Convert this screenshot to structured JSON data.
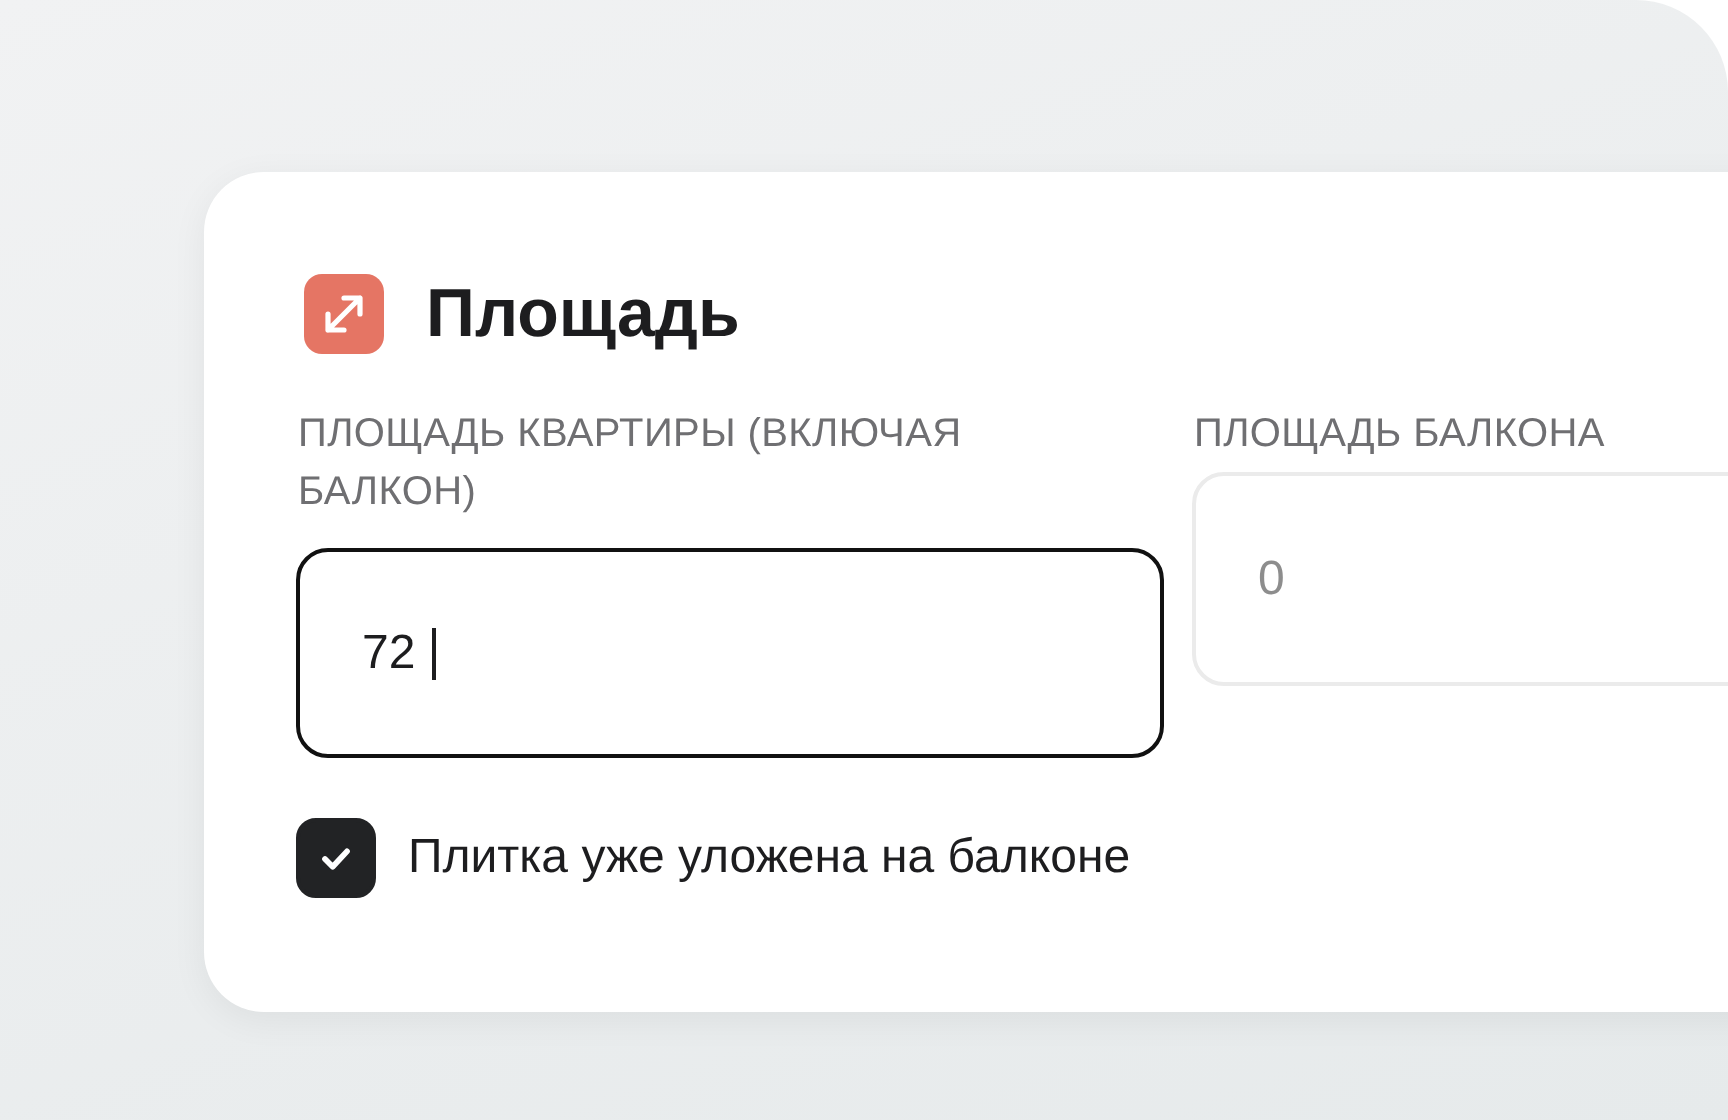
{
  "card": {
    "title": "Площадь",
    "fields": [
      {
        "label": "ПЛОЩАДЬ КВАРТИРЫ (ВКЛЮЧАЯ БАЛКОН)",
        "value": "72",
        "focused": true
      },
      {
        "label": "ПЛОЩАДЬ БАЛКОНА",
        "placeholder": "0",
        "focused": false
      }
    ],
    "checkbox": {
      "label": "Плитка уже уложена на балконе",
      "checked": true
    }
  }
}
